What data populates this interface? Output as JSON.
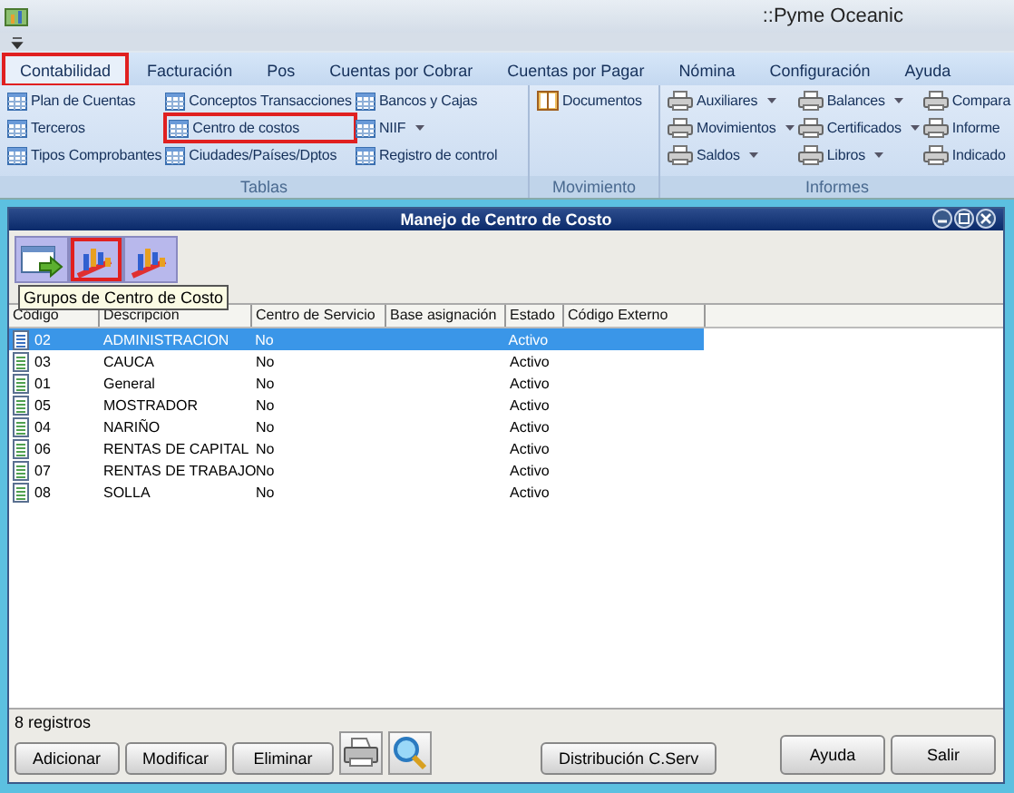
{
  "app": {
    "title": "::Pyme Oceanic"
  },
  "tabs": [
    {
      "label": "Contabilidad",
      "selected": true,
      "highlighted": true
    },
    {
      "label": "Facturación",
      "selected": false,
      "highlighted": false
    },
    {
      "label": "Pos",
      "selected": false,
      "highlighted": false
    },
    {
      "label": "Cuentas por Cobrar",
      "selected": false,
      "highlighted": false
    },
    {
      "label": "Cuentas por Pagar",
      "selected": false,
      "highlighted": false
    },
    {
      "label": "Nómina",
      "selected": false,
      "highlighted": false
    },
    {
      "label": "Configuración",
      "selected": false,
      "highlighted": false
    },
    {
      "label": "Ayuda",
      "selected": false,
      "highlighted": false
    }
  ],
  "ribbon_groups": [
    {
      "title": "Tablas",
      "kind": "table",
      "columns": [
        [
          {
            "label": "Plan de Cuentas",
            "dropdown": false,
            "highlighted": false
          },
          {
            "label": "Terceros",
            "dropdown": false,
            "highlighted": false
          },
          {
            "label": "Tipos Comprobantes",
            "dropdown": false,
            "highlighted": false
          }
        ],
        [
          {
            "label": "Conceptos Transacciones",
            "dropdown": false,
            "highlighted": false
          },
          {
            "label": "Centro de costos",
            "dropdown": false,
            "highlighted": true
          },
          {
            "label": "Ciudades/Países/Dptos",
            "dropdown": false,
            "highlighted": false
          }
        ],
        [
          {
            "label": "Bancos y Cajas",
            "dropdown": false,
            "highlighted": false
          },
          {
            "label": "NIIF",
            "dropdown": true,
            "highlighted": false
          },
          {
            "label": "Registro de control",
            "dropdown": false,
            "highlighted": false
          }
        ]
      ]
    },
    {
      "title": "Movimiento",
      "kind": "book",
      "columns": [
        [
          {
            "label": "Documentos",
            "dropdown": false,
            "highlighted": false
          }
        ]
      ]
    },
    {
      "title": "Informes",
      "kind": "printer",
      "columns": [
        [
          {
            "label": "Auxiliares",
            "dropdown": true,
            "highlighted": false
          },
          {
            "label": "Movimientos",
            "dropdown": true,
            "highlighted": false
          },
          {
            "label": "Saldos",
            "dropdown": true,
            "highlighted": false
          }
        ],
        [
          {
            "label": "Balances",
            "dropdown": true,
            "highlighted": false
          },
          {
            "label": "Certificados",
            "dropdown": true,
            "highlighted": false
          },
          {
            "label": "Libros",
            "dropdown": true,
            "highlighted": false
          }
        ],
        [
          {
            "label": "Compara",
            "dropdown": false,
            "highlighted": false
          },
          {
            "label": "Informe",
            "dropdown": false,
            "highlighted": false
          },
          {
            "label": "Indicado",
            "dropdown": false,
            "highlighted": false
          }
        ]
      ]
    }
  ],
  "window": {
    "title": "Manejo de Centro de Costo",
    "toolbar": [
      {
        "kind": "exit",
        "highlighted": false
      },
      {
        "kind": "chart",
        "highlighted": true
      },
      {
        "kind": "chart",
        "highlighted": false
      }
    ],
    "tooltip": "Grupos de Centro de Costo",
    "columns": [
      "Código",
      "Descripción",
      "Centro de Servicio",
      "Base asignación",
      "Estado",
      "Código Externo"
    ],
    "rows": [
      {
        "cells": [
          "02",
          "ADMINISTRACION",
          "No",
          "",
          "Activo",
          ""
        ],
        "selected": true
      },
      {
        "cells": [
          "03",
          "CAUCA",
          "No",
          "",
          "Activo",
          ""
        ],
        "selected": false
      },
      {
        "cells": [
          "01",
          "General",
          "No",
          "",
          "Activo",
          ""
        ],
        "selected": false
      },
      {
        "cells": [
          "05",
          "MOSTRADOR",
          "No",
          "",
          "Activo",
          ""
        ],
        "selected": false
      },
      {
        "cells": [
          "04",
          "NARIÑO",
          "No",
          "",
          "Activo",
          ""
        ],
        "selected": false
      },
      {
        "cells": [
          "06",
          "RENTAS DE CAPITAL",
          "No",
          "",
          "Activo",
          ""
        ],
        "selected": false
      },
      {
        "cells": [
          "07",
          "RENTAS DE TRABAJO",
          "No",
          "",
          "Activo",
          ""
        ],
        "selected": false
      },
      {
        "cells": [
          "08",
          "SOLLA",
          "No",
          "",
          "Activo",
          ""
        ],
        "selected": false
      }
    ],
    "record_count": "8 registros",
    "buttons": [
      {
        "kind": "text",
        "label": "Adicionar"
      },
      {
        "kind": "text",
        "label": "Modificar"
      },
      {
        "kind": "text",
        "label": "Eliminar"
      },
      {
        "kind": "printer"
      },
      {
        "kind": "search"
      },
      {
        "kind": "text",
        "label": "Distribución C.Serv"
      }
    ],
    "right_buttons": [
      "Ayuda",
      "Salir"
    ]
  }
}
